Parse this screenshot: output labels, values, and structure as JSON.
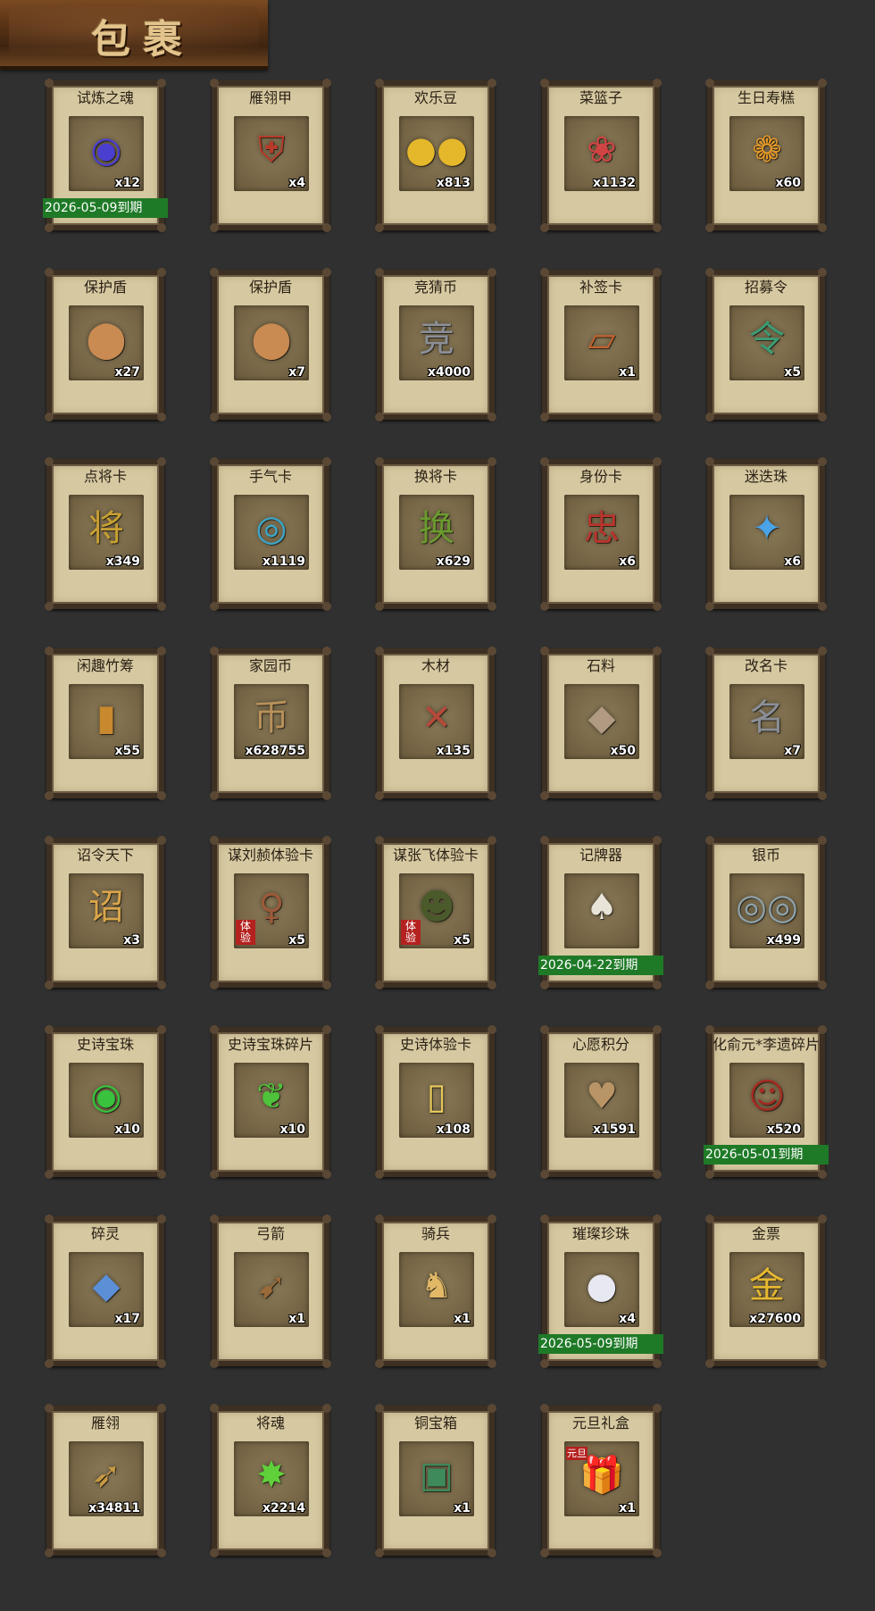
{
  "header": {
    "title": "包裹"
  },
  "items": [
    {
      "name": "试炼之魂",
      "qty": "x12",
      "glyph": "◉",
      "color": "#4b3fcf",
      "icon": "purple-orb-icon",
      "expiry": "2026-05-09到期"
    },
    {
      "name": "雁翎甲",
      "qty": "x4",
      "glyph": "⛨",
      "color": "#b83b2a",
      "icon": "armor-icon"
    },
    {
      "name": "欢乐豆",
      "qty": "x813",
      "glyph": "●●",
      "color": "#e5b72a",
      "icon": "gold-beans-icon"
    },
    {
      "name": "菜篮子",
      "qty": "x1132",
      "glyph": "❀",
      "color": "#d14444",
      "icon": "basket-icon"
    },
    {
      "name": "生日寿糕",
      "qty": "x60",
      "glyph": "❁",
      "color": "#e59a2a",
      "icon": "cake-icon"
    },
    {
      "name": "保护盾",
      "qty": "x27",
      "glyph": "⬤",
      "color": "#c98b52",
      "icon": "shield-icon"
    },
    {
      "name": "保护盾",
      "qty": "x7",
      "glyph": "⬤",
      "color": "#c98b52",
      "icon": "shield-icon"
    },
    {
      "name": "竞猜币",
      "qty": "x4000",
      "glyph": "竞",
      "color": "#8c8f96",
      "icon": "coin-icon"
    },
    {
      "name": "补签卡",
      "qty": "x1",
      "glyph": "▱",
      "color": "#c2622f",
      "icon": "card-icon"
    },
    {
      "name": "招募令",
      "qty": "x5",
      "glyph": "令",
      "color": "#3c9b73",
      "icon": "token-icon"
    },
    {
      "name": "点将卡",
      "qty": "x349",
      "glyph": "将",
      "color": "#c8a032",
      "icon": "general-card-icon"
    },
    {
      "name": "手气卡",
      "qty": "x1119",
      "glyph": "◎",
      "color": "#3ca6c9",
      "icon": "luck-card-icon"
    },
    {
      "name": "换将卡",
      "qty": "x629",
      "glyph": "换",
      "color": "#6b9a2e",
      "icon": "swap-card-icon"
    },
    {
      "name": "身份卡",
      "qty": "x6",
      "glyph": "忠",
      "color": "#b8342c",
      "icon": "identity-card-icon"
    },
    {
      "name": "迷迭珠",
      "qty": "x6",
      "glyph": "✦",
      "color": "#4aa3e6",
      "icon": "blue-orb-icon"
    },
    {
      "name": "闲趣竹筹",
      "qty": "x55",
      "glyph": "▮",
      "color": "#c8892f",
      "icon": "bamboo-token-icon"
    },
    {
      "name": "家园币",
      "qty": "x628755",
      "glyph": "币",
      "color": "#b8915a",
      "icon": "home-coin-icon"
    },
    {
      "name": "木材",
      "qty": "x135",
      "glyph": "✕",
      "color": "#b54a3a",
      "icon": "wood-icon"
    },
    {
      "name": "石料",
      "qty": "x50",
      "glyph": "◆",
      "color": "#b09a82",
      "icon": "stone-icon"
    },
    {
      "name": "改名卡",
      "qty": "x7",
      "glyph": "名",
      "color": "#8a8f96",
      "icon": "rename-card-icon"
    },
    {
      "name": "诏令天下",
      "qty": "x3",
      "glyph": "诏",
      "color": "#d9a54a",
      "icon": "scroll-icon"
    },
    {
      "name": "谋刘赪体验卡",
      "qty": "x5",
      "glyph": "♀",
      "color": "#9a5a3a",
      "icon": "portrait-icon",
      "trial": "体验"
    },
    {
      "name": "谋张飞体验卡",
      "qty": "x5",
      "glyph": "☻",
      "color": "#4a5a2a",
      "icon": "portrait-icon",
      "trial": "体验"
    },
    {
      "name": "记牌器",
      "qty": "",
      "glyph": "♠",
      "color": "#e8e4d8",
      "icon": "card-counter-icon",
      "expiry": "2026-04-22到期"
    },
    {
      "name": "银币",
      "qty": "x499",
      "glyph": "◎◎",
      "color": "#8ea1a8",
      "icon": "silver-coin-icon"
    },
    {
      "name": "史诗宝珠",
      "qty": "x10",
      "glyph": "◉",
      "color": "#39c23d",
      "icon": "green-orb-icon"
    },
    {
      "name": "史诗宝珠碎片",
      "qty": "x10",
      "glyph": "❦",
      "color": "#4ec23a",
      "icon": "green-shard-icon"
    },
    {
      "name": "史诗体验卡",
      "qty": "x108",
      "glyph": "▯",
      "color": "#e6c85a",
      "icon": "trial-card-icon"
    },
    {
      "name": "心愿积分",
      "qty": "x1591",
      "glyph": "♥",
      "color": "#b89466",
      "icon": "wish-coin-icon"
    },
    {
      "name": "化俞元*李遗碎片",
      "qty": "x520",
      "glyph": "☺",
      "color": "#a42c22",
      "icon": "portrait-icon",
      "expiry": "2026-05-01到期"
    },
    {
      "name": "碎灵",
      "qty": "x17",
      "glyph": "◆",
      "color": "#5b8fd6",
      "icon": "crystal-icon"
    },
    {
      "name": "弓箭",
      "qty": "x1",
      "glyph": "➹",
      "color": "#9a6a3a",
      "icon": "bow-icon"
    },
    {
      "name": "骑兵",
      "qty": "x1",
      "glyph": "♞",
      "color": "#e0b866",
      "icon": "cavalry-icon"
    },
    {
      "name": "璀璨珍珠",
      "qty": "x4",
      "glyph": "●",
      "color": "#e8e8f2",
      "icon": "pearl-icon",
      "expiry": "2026-05-09到期"
    },
    {
      "name": "金票",
      "qty": "x27600",
      "glyph": "金",
      "color": "#e6b830",
      "icon": "gold-ticket-icon"
    },
    {
      "name": "雁翎",
      "qty": "x34811",
      "glyph": "➶",
      "color": "#c89a42",
      "icon": "feather-icon"
    },
    {
      "name": "将魂",
      "qty": "x2214",
      "glyph": "✸",
      "color": "#5fd03a",
      "icon": "soul-icon"
    },
    {
      "name": "铜宝箱",
      "qty": "x1",
      "glyph": "▣",
      "color": "#3e8a5a",
      "icon": "chest-icon"
    },
    {
      "name": "元旦礼盒",
      "qty": "x1",
      "glyph": "🎁",
      "color": "#3a7acb",
      "icon": "gift-box-icon",
      "badge": "元旦"
    }
  ]
}
